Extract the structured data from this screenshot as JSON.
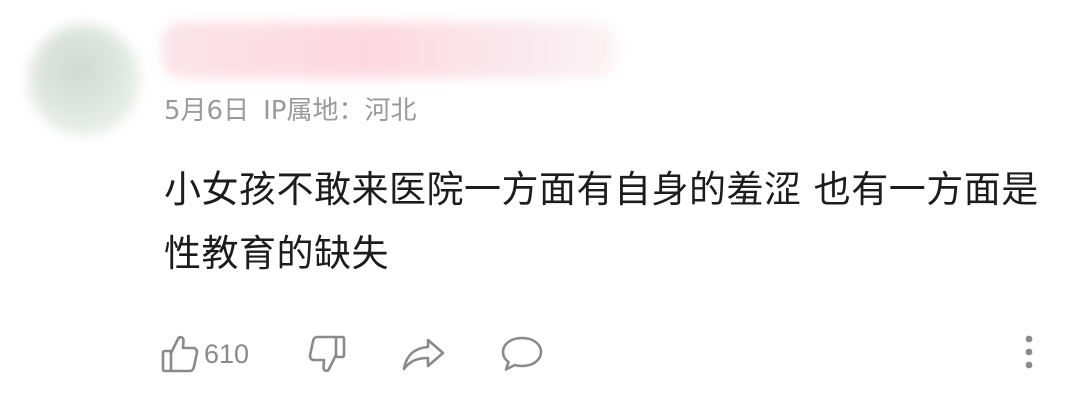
{
  "comment": {
    "date": "5月6日",
    "ip_location": "IP属地：河北",
    "body": "小女孩不敢来医院一方面有自身的羞涩 也有一方面是性教育的缺失",
    "like_count": "610"
  },
  "icons": {
    "like": "thumbs-up-icon",
    "dislike": "thumbs-down-icon",
    "share": "share-arrow-icon",
    "reply": "speech-bubble-icon",
    "more": "vertical-ellipsis-icon"
  },
  "colors": {
    "meta_text": "#9a9a9a",
    "body_text": "#1c1c1c",
    "icon": "#8a8a8a",
    "username_blur": "#fbd9e3"
  }
}
